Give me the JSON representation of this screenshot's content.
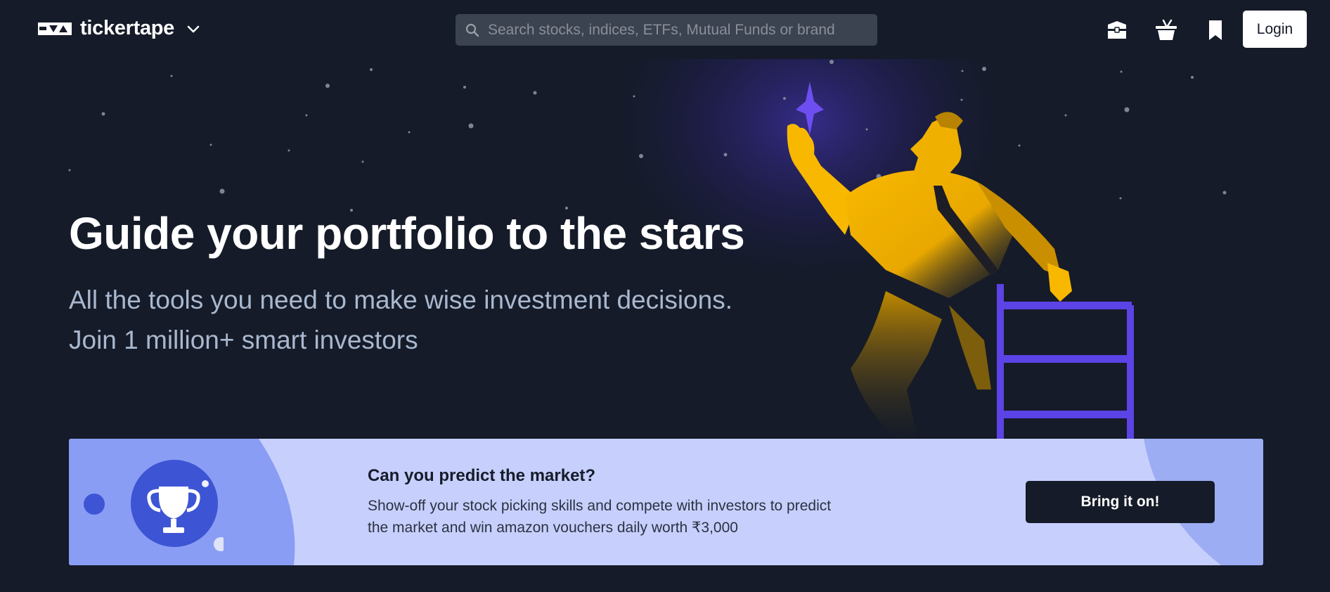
{
  "brand": {
    "name": "tickertape",
    "logo_icon": "tickertape-logo-icon",
    "switch_icon": "chevron-down-icon"
  },
  "search": {
    "placeholder": "Search stocks, indices, ETFs, Mutual Funds or brand",
    "value": "",
    "icon": "search-icon"
  },
  "header_actions": {
    "icons": [
      "briefcase-icon",
      "basket-icon",
      "bookmark-icon"
    ],
    "login_label": "Login"
  },
  "hero": {
    "title": "Guide your portfolio to the stars",
    "subtitle_line1": "All the tools you need to make wise investment decisions.",
    "subtitle_line2": "Join 1 million+ smart investors"
  },
  "banner": {
    "title": "Can you predict the market?",
    "description": "Show-off your stock picking skills and compete with investors to predict the market and win amazon vouchers daily worth ₹3,000",
    "cta_label": "Bring it on!",
    "icon": "trophy-icon"
  },
  "colors": {
    "background": "#151b28",
    "accent_purple": "#5b43e6",
    "figure_yellow": "#f7b500",
    "banner_bg": "#c7d0fd",
    "banner_circle": "#3d55d4",
    "hero_subtitle": "#a9b8cf"
  }
}
